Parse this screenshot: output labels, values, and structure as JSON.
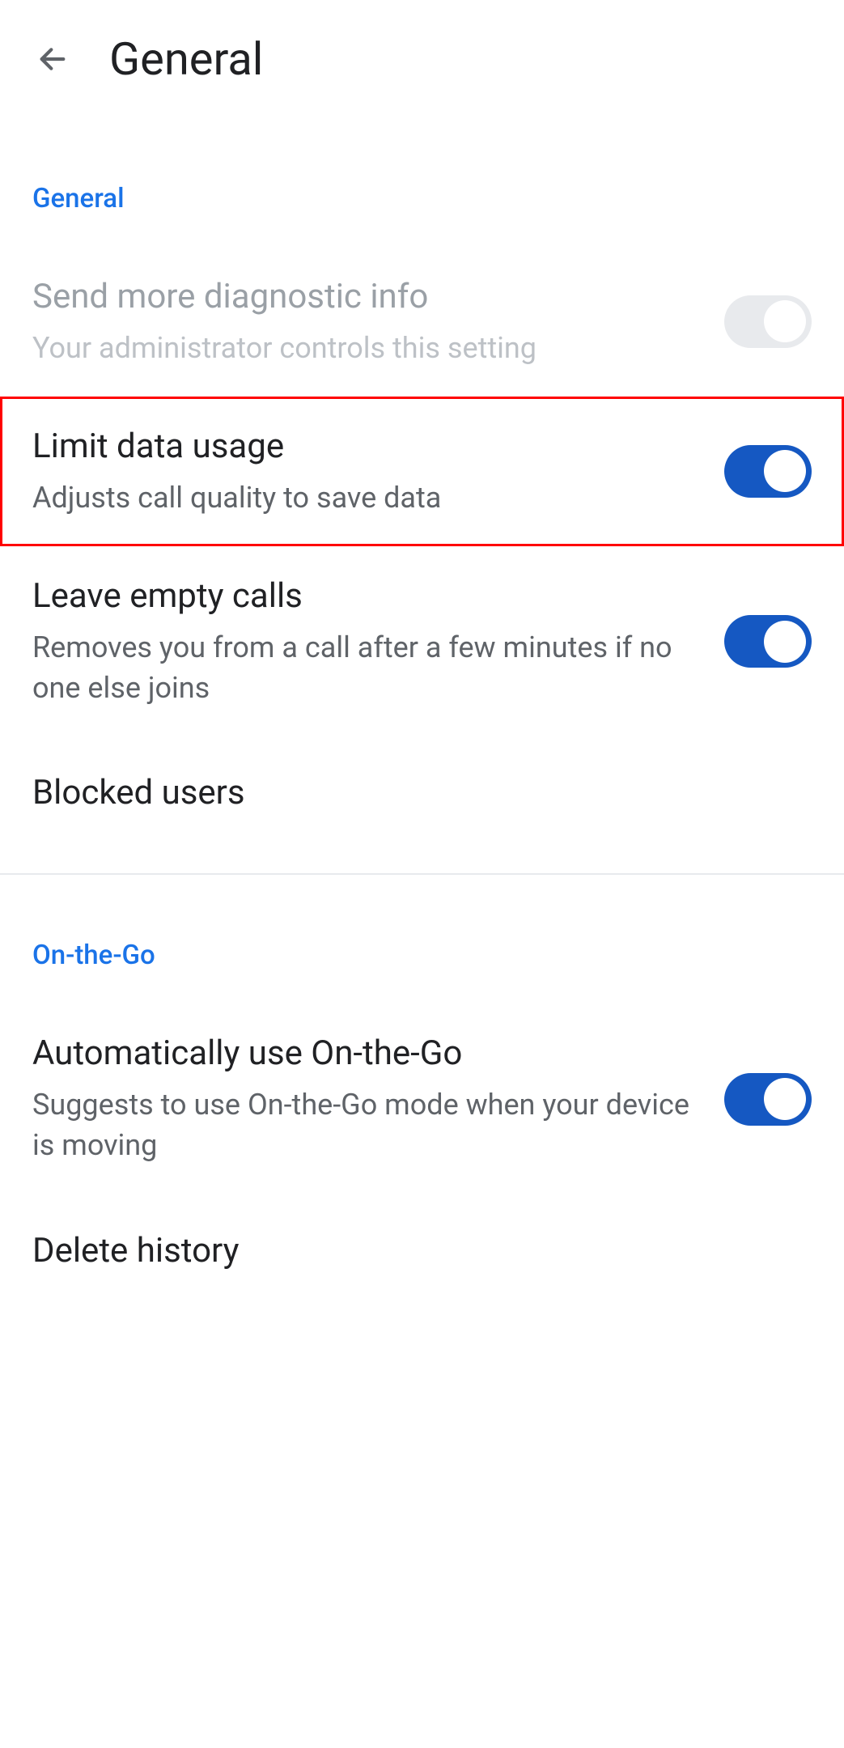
{
  "header": {
    "title": "General"
  },
  "sections": {
    "general": {
      "label": "General",
      "items": {
        "diagnostic": {
          "title": "Send more diagnostic info",
          "subtitle": "Your administrator controls this setting"
        },
        "limitData": {
          "title": "Limit data usage",
          "subtitle": "Adjusts call quality to save data"
        },
        "leaveEmpty": {
          "title": "Leave empty calls",
          "subtitle": "Removes you from a call after a few minutes if no one else joins"
        },
        "blockedUsers": {
          "title": "Blocked users"
        }
      }
    },
    "onTheGo": {
      "label": "On-the-Go",
      "items": {
        "autoOnTheGo": {
          "title": "Automatically use On-the-Go",
          "subtitle": "Suggests to use On-the-Go mode when your device is moving"
        },
        "deleteHistory": {
          "title": "Delete history"
        }
      }
    }
  }
}
